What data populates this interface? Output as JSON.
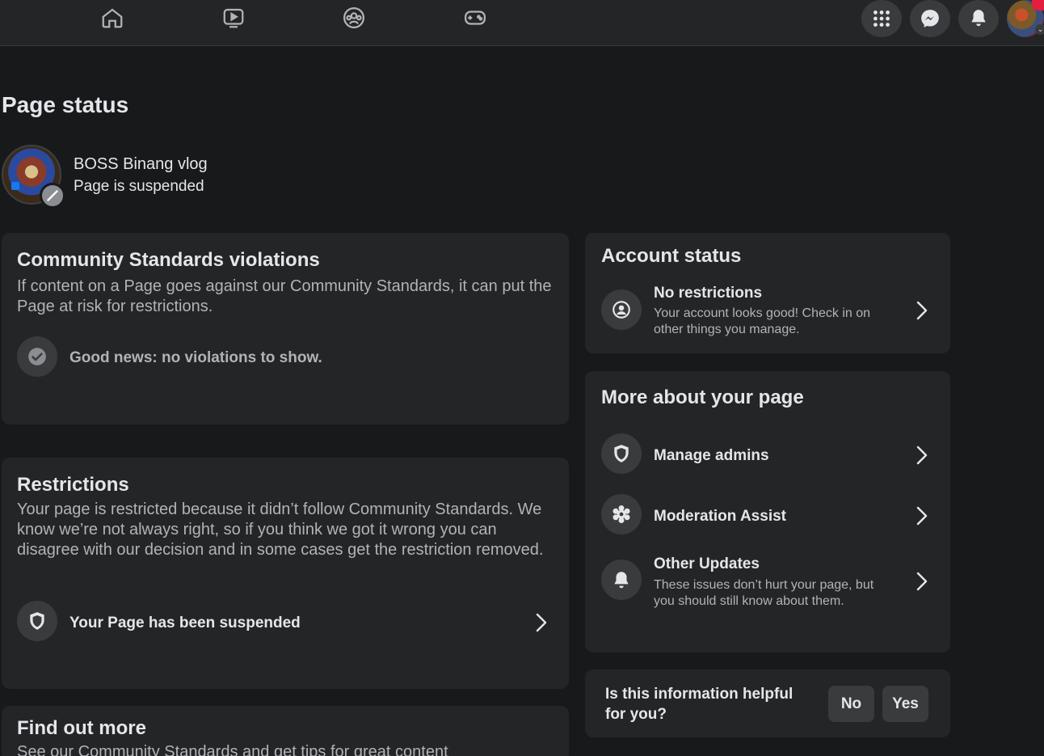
{
  "nav": {
    "tabs": [
      "home-icon",
      "watch-icon",
      "groups-icon",
      "gaming-icon"
    ],
    "actions": [
      "menu-grid-icon",
      "messenger-icon",
      "bell-icon"
    ],
    "avatar_chevron": "⌄"
  },
  "page": {
    "title": "Page status",
    "name": "BOSS Binang vlog",
    "status": "Page is suspended"
  },
  "violations": {
    "title": "Community Standards violations",
    "description": "If content on a Page goes against our Community Standards, it can put the Page at risk for restrictions.",
    "good_news": "Good news: no violations to show."
  },
  "restrictions": {
    "title": "Restrictions",
    "description": "Your page is restricted because it didn’t follow Community Standards. We know we’re not always right, so if you think we got it wrong you can disagree with our decision and in some cases get the restriction removed.",
    "item_label": "Your Page has been suspended"
  },
  "find_out_more": {
    "title": "Find out more",
    "description": "See our Community Standards and get tips for great content"
  },
  "account_status": {
    "title": "Account status",
    "item_title": "No restrictions",
    "item_desc": "Your account looks good! Check in on other things you manage."
  },
  "more_about": {
    "title": "More about your page",
    "items": [
      {
        "label": "Manage admins"
      },
      {
        "label": "Moderation Assist"
      },
      {
        "label": "Other Updates",
        "desc": "These issues don’t hurt your page, but you should still know about them."
      }
    ]
  },
  "feedback": {
    "question": "Is this information helpful for you?",
    "no_label": "No",
    "yes_label": "Yes"
  },
  "colors": {
    "background": "#18191a",
    "card": "#242526",
    "icon_bg": "#3a3b3c",
    "primary_text": "#e4e6eb",
    "secondary_text": "#b0b3b8",
    "notification": "#e41e3f"
  }
}
